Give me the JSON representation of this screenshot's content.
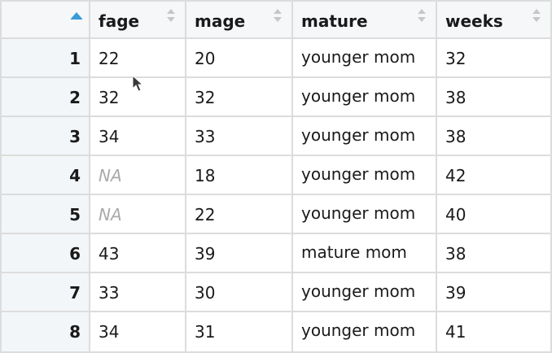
{
  "table": {
    "rowname_header": "",
    "columns": [
      "fage",
      "mage",
      "mature",
      "weeks"
    ],
    "rows": [
      {
        "id": "1",
        "fage": "22",
        "mage": "20",
        "mature": "younger mom",
        "weeks": "32"
      },
      {
        "id": "2",
        "fage": "32",
        "mage": "32",
        "mature": "younger mom",
        "weeks": "38"
      },
      {
        "id": "3",
        "fage": "34",
        "mage": "33",
        "mature": "younger mom",
        "weeks": "38"
      },
      {
        "id": "4",
        "fage": "NA",
        "mage": "18",
        "mature": "younger mom",
        "weeks": "42"
      },
      {
        "id": "5",
        "fage": "NA",
        "mage": "22",
        "mature": "younger mom",
        "weeks": "40"
      },
      {
        "id": "6",
        "fage": "43",
        "mage": "39",
        "mature": "mature mom",
        "weeks": "38"
      },
      {
        "id": "7",
        "fage": "33",
        "mage": "30",
        "mature": "younger mom",
        "weeks": "39"
      },
      {
        "id": "8",
        "fage": "34",
        "mage": "31",
        "mature": "younger mom",
        "weeks": "41"
      }
    ],
    "active_sort_column": "rowname",
    "active_sort_direction": "ascending"
  },
  "icons": {
    "active_sort": "sort-ascending-icon",
    "inactive_sort": "sort-both-icon",
    "cursor": "mouse-pointer-icon"
  },
  "colors": {
    "header_bg": "#f5f7f9",
    "rowname_bg": "#f3f6f8",
    "border": "#dcdcdc",
    "na_text": "#aaaaaa",
    "sort_active": "#3c9bd6",
    "sort_inactive": "#c7c7c7"
  }
}
